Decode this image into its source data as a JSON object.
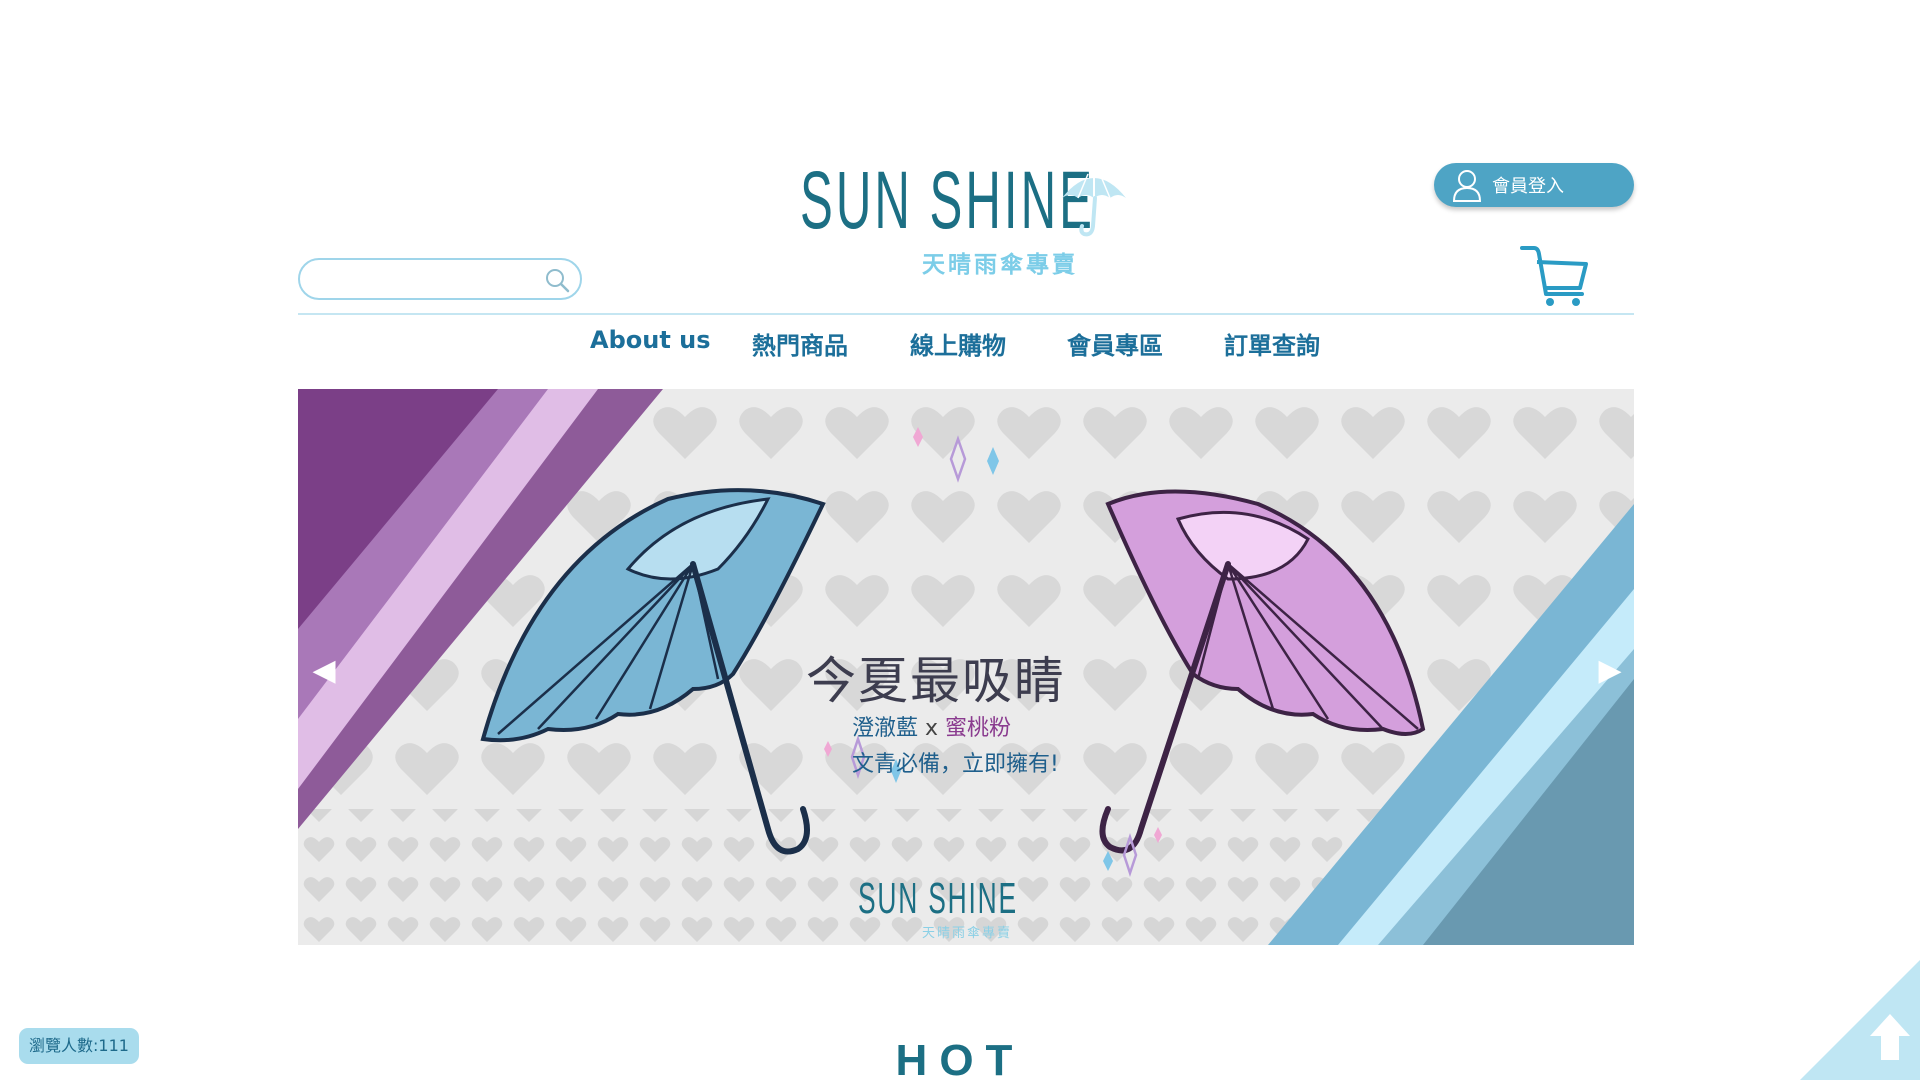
{
  "header": {
    "logo_text": "SUN SHINE",
    "logo_subtitle": "天晴雨傘專賣",
    "login_label": "會員登入",
    "search_placeholder": ""
  },
  "nav": {
    "items": [
      {
        "label": "About us"
      },
      {
        "label": "熱門商品"
      },
      {
        "label": "線上購物"
      },
      {
        "label": "會員專區"
      },
      {
        "label": "訂單查詢"
      }
    ]
  },
  "banner": {
    "headline": "今夏最吸睛",
    "subtitle_blue": "澄澈藍",
    "subtitle_x": " x ",
    "subtitle_pink": "蜜桃粉",
    "subtitle2": "文青必備，立即擁有!",
    "logo_text": "SUN SHINE",
    "logo_subtitle": "天晴雨傘專賣",
    "prev_arrow": "◀",
    "next_arrow": "▶"
  },
  "footer": {
    "visitor_count": "瀏覽人數:111",
    "section_title": "HOT"
  },
  "icons": {
    "search": "search-icon",
    "cart": "cart-icon",
    "user": "user-icon",
    "to_top": "arrow-up-icon"
  },
  "colors": {
    "brand_teal": "#1c6f84",
    "light_blue": "#7ccde8",
    "login_bg": "#4ea4c5",
    "purple_accent": "#7b3f87",
    "blue_accent": "#7ab6d4"
  }
}
